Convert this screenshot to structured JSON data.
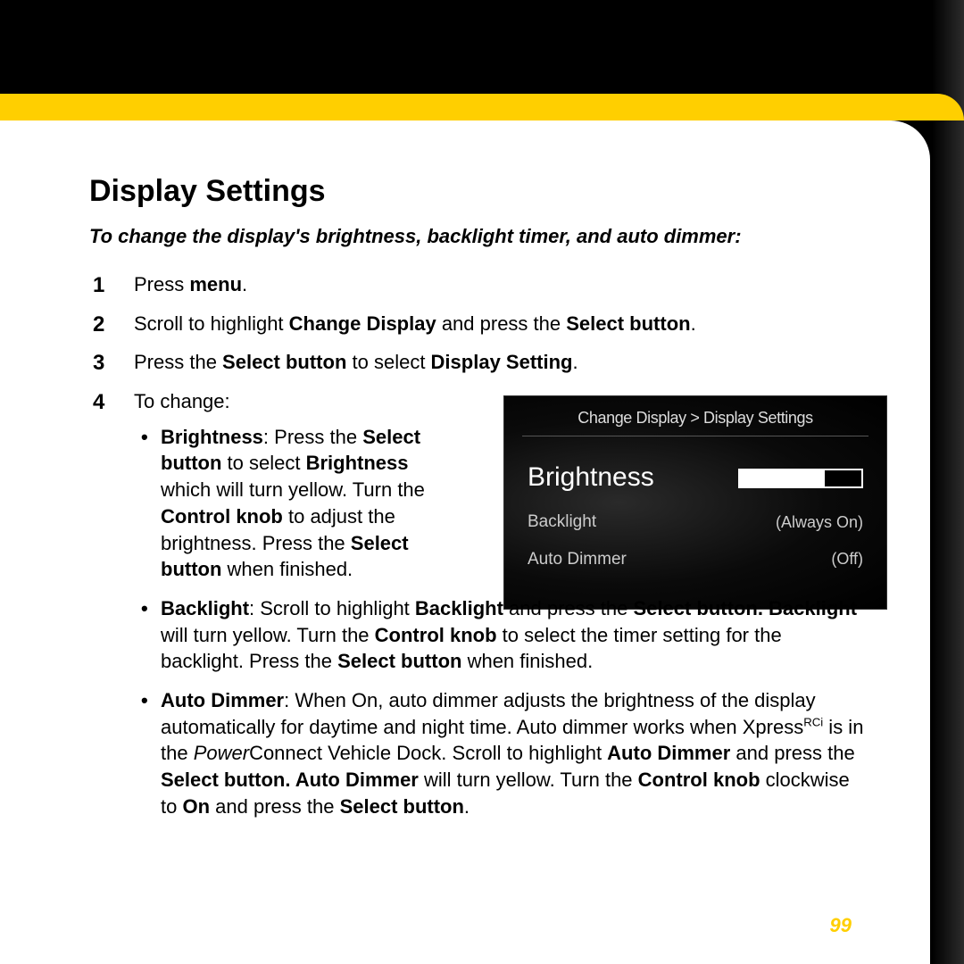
{
  "title": "Display Settings",
  "intro": "To change the display's brightness, backlight timer, and auto dimmer:",
  "steps": {
    "s1": {
      "press": "Press ",
      "menu": "menu",
      "dot": "."
    },
    "s2": {
      "a": "Scroll to highlight ",
      "cd": "Change Display",
      "b": " and press the ",
      "sb": "Select button",
      "dot": "."
    },
    "s3": {
      "a": "Press the ",
      "sb": "Select button",
      "b": " to select ",
      "ds": "Display Setting",
      "dot": "."
    },
    "s4": {
      "label": "To change:"
    }
  },
  "bullets": {
    "brightness": {
      "h": "Brightness",
      "a": ": Press the ",
      "sb1": "Select button",
      "b": " to select ",
      "br": "Brightness",
      "c": " which will turn yellow. Turn the ",
      "ck": "Control knob",
      "d": " to adjust the brightness. Press the ",
      "sb2": "Select button",
      "e": " when finished."
    },
    "backlight": {
      "h": "Backlight",
      "a": ": Scroll to highlight ",
      "bl": "Backlight",
      "b": " and press the ",
      "sb1": "Select button. Backlight",
      "c": " will turn yellow. Turn the ",
      "ck": "Control knob",
      "d": " to select the timer setting for the backlight. Press the ",
      "sb2": "Select button",
      "e": " when finished."
    },
    "autodimmer": {
      "h": "Auto Dimmer",
      "a": ": When On, auto dimmer adjusts the brightness of the display automatically for daytime and night time. Auto dimmer works when Xpress",
      "sup": "RCi",
      "b": " is in the ",
      "pc": "Power",
      "c": "Connect Vehicle Dock. Scroll to highlight ",
      "ad": "Auto Dimmer",
      "d": " and press the ",
      "sb1": "Select button. Auto Dimmer",
      "e": " will turn yellow. Turn the ",
      "ck": "Control knob",
      "f": " clockwise to ",
      "on": "On",
      "g": " and press the ",
      "sb2": "Select button",
      "dot": "."
    }
  },
  "device": {
    "breadcrumb": "Change Display > Display Settings",
    "rows": [
      {
        "label": "Brightness",
        "value_pct": 70,
        "selected": true
      },
      {
        "label": "Backlight",
        "value": "(Always On)"
      },
      {
        "label": "Auto Dimmer",
        "value": "(Off)"
      }
    ]
  },
  "page_number": "99"
}
